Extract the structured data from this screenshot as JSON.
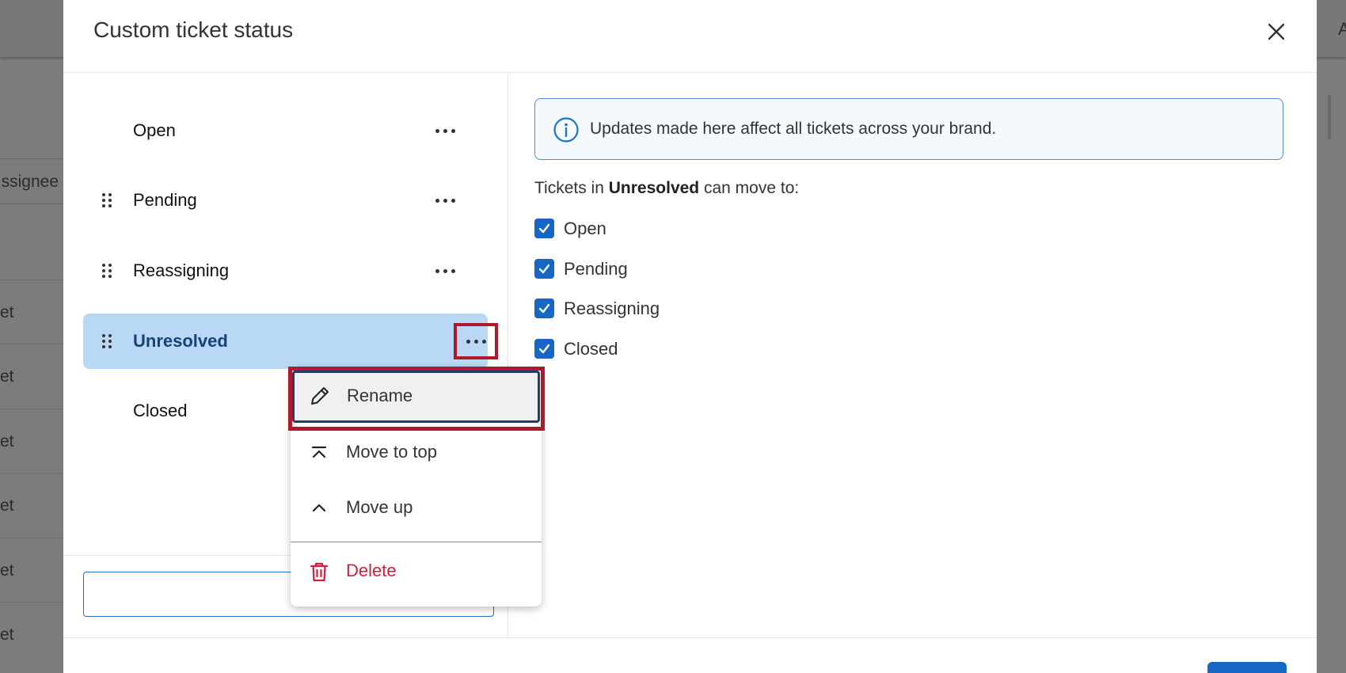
{
  "background": {
    "column_header": "ssignee",
    "row_fragment": "et",
    "top_right_letter": "A",
    "row_count": 6
  },
  "modal": {
    "title": "Custom ticket status",
    "close_icon": "close-icon"
  },
  "statuses": [
    {
      "label": "Open",
      "draggable": false,
      "selected": false
    },
    {
      "label": "Pending",
      "draggable": true,
      "selected": false
    },
    {
      "label": "Reassigning",
      "draggable": true,
      "selected": false
    },
    {
      "label": "Unresolved",
      "draggable": true,
      "selected": true
    },
    {
      "label": "Closed",
      "draggable": false,
      "selected": false
    }
  ],
  "menu": {
    "items": [
      {
        "label": "Rename",
        "icon": "pencil-icon"
      },
      {
        "label": "Move to top",
        "icon": "move-to-top-icon"
      },
      {
        "label": "Move up",
        "icon": "chevron-up-icon"
      },
      {
        "label": "Delete",
        "icon": "trash-icon"
      }
    ]
  },
  "info": {
    "icon": "info-icon",
    "text": "Updates made here affect all tickets across your brand."
  },
  "transitions": {
    "prefix": "Tickets in",
    "status": "Unresolved",
    "suffix": "can move to:",
    "options": [
      {
        "label": "Open",
        "checked": true
      },
      {
        "label": "Pending",
        "checked": true
      },
      {
        "label": "Reassigning",
        "checked": true
      },
      {
        "label": "Closed",
        "checked": true
      }
    ]
  },
  "colors": {
    "accent": "#1566c5",
    "selected_row": "#b9d8f5",
    "highlight": "#b0182c",
    "danger": "#d61c3c"
  }
}
